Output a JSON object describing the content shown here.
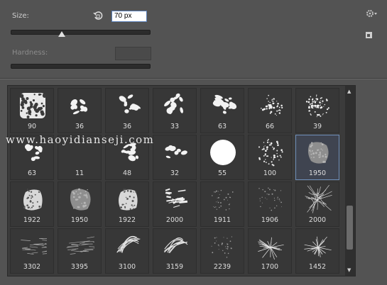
{
  "size": {
    "label": "Size:",
    "value": "70 px",
    "slider_fraction": 0.37
  },
  "hardness": {
    "label": "Hardness:",
    "value": "",
    "slider_fraction": 1.0
  },
  "icons": {
    "reset": "reset-arrow-icon",
    "settings": "gear-icon",
    "new_preset": "new-preset-icon",
    "scroll_up": "scroll-up-arrow-icon",
    "scroll_down": "scroll-down-arrow-icon"
  },
  "watermark": "www.haoyidianseji.com",
  "brushes": [
    {
      "size": "90",
      "style": "sponge"
    },
    {
      "size": "36",
      "style": "leafy"
    },
    {
      "size": "36",
      "style": "leafy"
    },
    {
      "size": "33",
      "style": "leafy"
    },
    {
      "size": "63",
      "style": "leafy-large"
    },
    {
      "size": "66",
      "style": "spatter"
    },
    {
      "size": "39",
      "style": "spatter-dense"
    },
    {
      "size": "63",
      "style": "leafy"
    },
    {
      "size": "11",
      "style": "blank"
    },
    {
      "size": "48",
      "style": "leafy"
    },
    {
      "size": "32",
      "style": "leafy-small"
    },
    {
      "size": "55",
      "style": "round"
    },
    {
      "size": "100",
      "style": "spatter-ring"
    },
    {
      "size": "1950",
      "style": "chalk",
      "selected": true
    },
    {
      "size": "1922",
      "style": "dry-blob"
    },
    {
      "size": "1950",
      "style": "chalk"
    },
    {
      "size": "1922",
      "style": "dry-blob"
    },
    {
      "size": "2000",
      "style": "rough"
    },
    {
      "size": "1911",
      "style": "faint"
    },
    {
      "size": "1906",
      "style": "faint"
    },
    {
      "size": "2000",
      "style": "fiber"
    },
    {
      "size": "3302",
      "style": "streak"
    },
    {
      "size": "3395",
      "style": "streak"
    },
    {
      "size": "3100",
      "style": "swirl"
    },
    {
      "size": "3159",
      "style": "swirl"
    },
    {
      "size": "2239",
      "style": "faint-scatter"
    },
    {
      "size": "1700",
      "style": "burst"
    },
    {
      "size": "1452",
      "style": "burst"
    }
  ]
}
